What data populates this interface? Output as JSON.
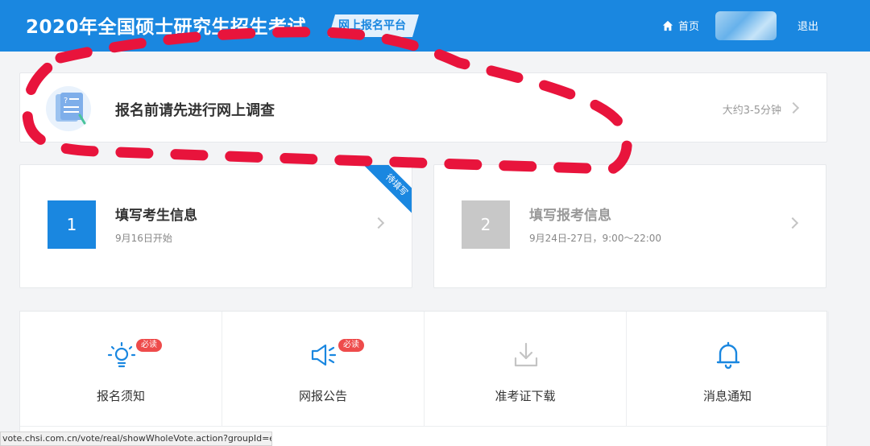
{
  "header": {
    "title": "2020年全国硕士研究生招生考试",
    "platform_tag": "网上报名平台",
    "home_label": "首页",
    "logout_label": "退出"
  },
  "survey": {
    "title": "报名前请先进行网上调查",
    "time": "大约3-5分钟"
  },
  "steps": [
    {
      "number": "1",
      "title": "填写考生信息",
      "subtitle": "9月16日开始",
      "ribbon": "待填写"
    },
    {
      "number": "2",
      "title": "填写报考信息",
      "subtitle": "9月24日-27日，9:00～22:00"
    }
  ],
  "grid": [
    {
      "label": "报名须知",
      "badge": "必读",
      "icon": "lightbulb-icon"
    },
    {
      "label": "网报公告",
      "badge": "必读",
      "icon": "megaphone-icon"
    },
    {
      "label": "准考证下载",
      "icon": "download-icon"
    },
    {
      "label": "消息通知",
      "icon": "bell-icon"
    }
  ],
  "status_bar": {
    "url": "vote.chsi.com.cn/vote/real/showWholeVote.action?groupId=enyjko..."
  },
  "colors": {
    "primary": "#1a87e0",
    "badge": "#ee4b4b",
    "annotation": "#e8143c",
    "disabled": "#c8c8c8"
  }
}
